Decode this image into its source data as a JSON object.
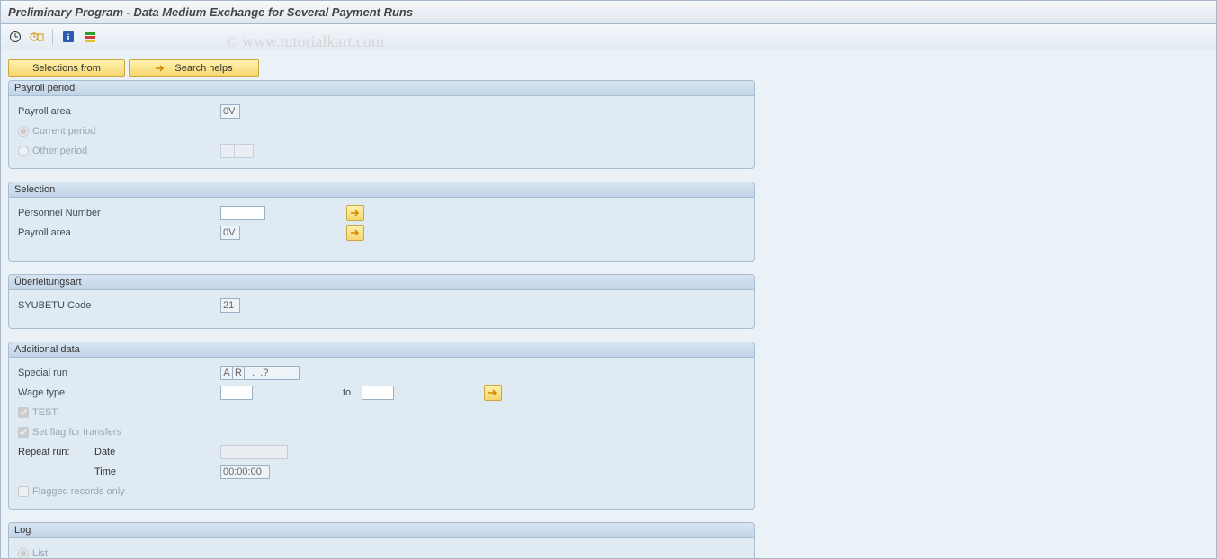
{
  "title": "Preliminary Program - Data Medium Exchange for Several Payment Runs",
  "watermark": "© www.tutorialkart.com",
  "toolbar": {
    "icons": [
      "execute-icon",
      "execute-print-icon",
      "info-icon",
      "variant-icon"
    ]
  },
  "buttons": {
    "selections_from": "Selections from",
    "search_helps": "Search helps"
  },
  "groups": {
    "payroll_period": {
      "title": "Payroll period",
      "payroll_area_label": "Payroll area",
      "payroll_area_value": "0V",
      "current_period_label": "Current period",
      "current_period_checked": true,
      "other_period_label": "Other period",
      "other_period_checked": false
    },
    "selection": {
      "title": "Selection",
      "personnel_number_label": "Personnel Number",
      "personnel_number_value": "",
      "payroll_area_label": "Payroll area",
      "payroll_area_value": "0V"
    },
    "uberleitung": {
      "title": "Überleitungsart",
      "syubetu_label": "SYUBETU Code",
      "syubetu_value": "21"
    },
    "additional": {
      "title": "Additional data",
      "special_run_label": "Special run",
      "special_run_v1": "A",
      "special_run_v2": "R",
      "special_run_v3": "  .  .?",
      "wage_type_label": "Wage type",
      "wage_type_from": "",
      "to_label": "to",
      "wage_type_to": "",
      "test_label": "TEST",
      "test_checked": true,
      "setflag_label": "Set flag for transfers",
      "setflag_checked": true,
      "repeat_run_label": "Repeat run:",
      "date_label": "Date",
      "date_value": "",
      "time_label": "Time",
      "time_value": "00:00:00",
      "flagged_label": "Flagged records only",
      "flagged_checked": false
    },
    "log": {
      "title": "Log",
      "list_label": "List",
      "list_checked": true
    }
  }
}
